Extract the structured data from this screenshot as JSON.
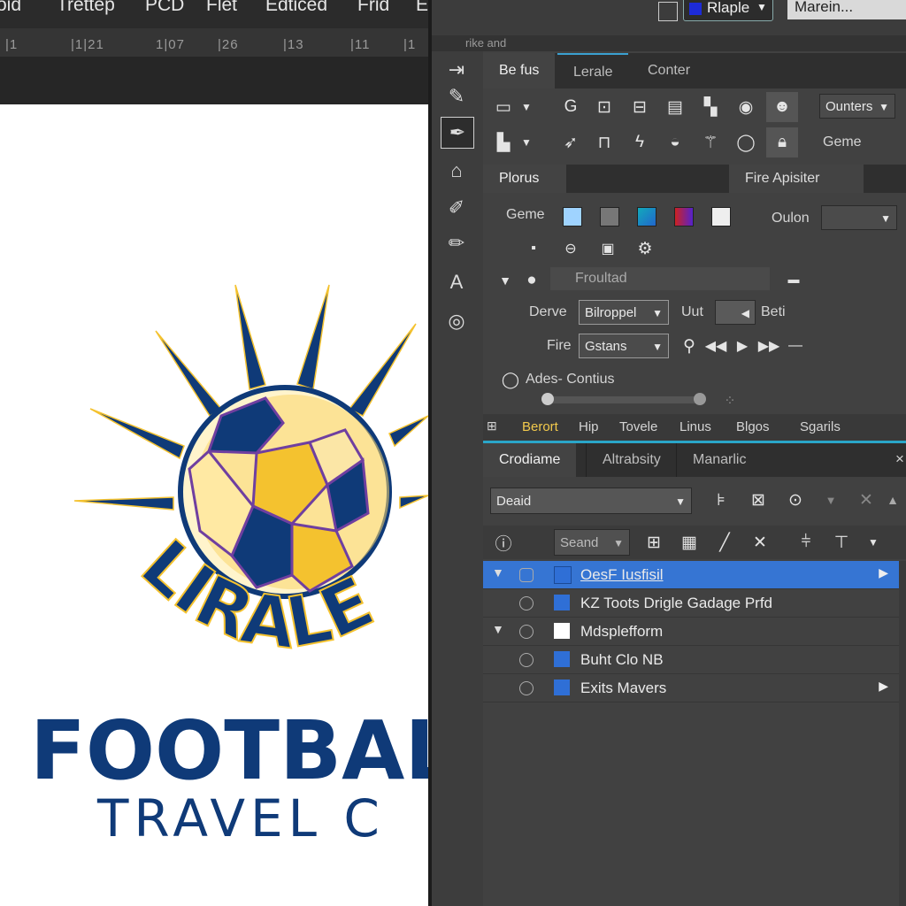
{
  "menubar": [
    "oid",
    "Trettep",
    "PCD",
    "Flet",
    "Edticed",
    "Frid",
    "E"
  ],
  "ruler": [
    "|1",
    "|1|21",
    "1|07",
    "|26",
    "|13",
    "|11",
    "|1"
  ],
  "topstrip": {
    "color_dropdown": "Rlaple",
    "right_label": "Marein..."
  },
  "subtitle": "rike and",
  "logo": {
    "arc_text": "LIRALE",
    "word1": "FOOTBAL",
    "word2": "TRAVEL C",
    "navy": "#0f3a78",
    "gold": "#f4c22f"
  },
  "tools_panel": {
    "tabs": [
      "Be fus",
      "Lerale",
      "Conter"
    ],
    "dropdown": "Ounters",
    "label": "Geme"
  },
  "props_panel": {
    "tabs": [
      "Plorus",
      "Fire Apisiter"
    ],
    "geme_label": "Geme",
    "oulon_label": "Oulon",
    "froultad": "Froultad",
    "derive_label": "Derve",
    "derive_value": "Bilroppel",
    "unit_label": "Uut",
    "beti_label": "Beti",
    "fire_label": "Fire",
    "fire_value": "Gstans",
    "ades_label": "Ades- Contius"
  },
  "tabstrip": [
    "Berort",
    "Hip",
    "Tovele",
    "Linus",
    "Blgos",
    "Sgarils"
  ],
  "layers_panel": {
    "tabs": [
      "Crodiame",
      "Altrabsity",
      "Manarlic"
    ],
    "close": "×",
    "blend": "Deaid",
    "search": "Seand",
    "rows": [
      {
        "name": "OesF Iusfisil",
        "color": "#2f6fd6",
        "expanded": true,
        "selected": true,
        "arrow": true
      },
      {
        "name": "KZ Toots Drigle Gadage Prfd",
        "color": "#2f6fd6",
        "expanded": false,
        "selected": false,
        "arrow": false
      },
      {
        "name": "Mdsplefform",
        "color": "#ffffff",
        "expanded": true,
        "selected": false,
        "arrow": false
      },
      {
        "name": "Buht Clo NB",
        "color": "#2f6fd6",
        "expanded": false,
        "selected": false,
        "arrow": false
      },
      {
        "name": "Exits Mavers",
        "color": "#2f6fd6",
        "expanded": false,
        "selected": false,
        "arrow": true
      }
    ]
  },
  "accent": "#2f6fd6",
  "selection_color": "#3675d3"
}
